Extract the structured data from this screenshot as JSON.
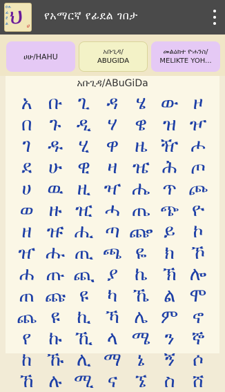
{
  "app": {
    "title": "የአማርኛ የፊደል ገበታ",
    "logo_main": "ህ",
    "logo_side": "የሐ ፊ ደ ል",
    "logo_corner": "ሀ"
  },
  "tabs": [
    {
      "line1": "ሀሁ/HAHU",
      "line2": ""
    },
    {
      "line1": "አቡጊዳ/",
      "line2": "ABUGIDA"
    },
    {
      "line1": "መልዕክተ ዮሐንስ/",
      "line2": "MELIKTE YOH..."
    }
  ],
  "content": {
    "subtitle": "አቡጊዳ/ABuGiDa"
  },
  "grid_rows": [
    [
      "አ",
      "ቡ",
      "ጊ",
      "ዳ",
      "ሄ",
      "ው",
      "ዞ"
    ],
    [
      "በ",
      "ጉ",
      "ዲ",
      "ሃ",
      "ዌ",
      "ዝ",
      "ዦ"
    ],
    [
      "ገ",
      "ዱ",
      "ሂ",
      "ዋ",
      "ዜ",
      "ዥ",
      "ሖ"
    ],
    [
      "ደ",
      "ሁ",
      "ዊ",
      "ዛ",
      "ዤ",
      "ሕ",
      "ጦ"
    ],
    [
      "ሀ",
      "ዉ",
      "ዚ",
      "ዣ",
      "ሔ",
      "ጥ",
      "ጮ"
    ],
    [
      "ወ",
      "ዙ",
      "ዢ",
      "ሓ",
      "ጤ",
      "ጭ",
      "ዮ"
    ],
    [
      "ዘ",
      "ዡ",
      "ሒ",
      "ጣ",
      "ጬ",
      "ይ",
      "ኮ"
    ],
    [
      "ዠ",
      "ሑ",
      "ጢ",
      "ጫ",
      "ዬ",
      "ክ",
      "ኾ"
    ],
    [
      "ሐ",
      "ጡ",
      "ጪ",
      "ያ",
      "ኬ",
      "ኽ",
      "ሎ"
    ],
    [
      "ጠ",
      "ጩ",
      "ዩ",
      "ካ",
      "ኼ",
      "ል",
      "ሞ"
    ],
    [
      "ጨ",
      "ዩ",
      "ኪ",
      "ኻ",
      "ሌ",
      "ም",
      "ኖ"
    ],
    [
      "የ",
      "ኩ",
      "ኺ",
      "ላ",
      "ሜ",
      "ን",
      "ኞ"
    ],
    [
      "ከ",
      "ኹ",
      "ሊ",
      "ማ",
      "ኔ",
      "ኝ",
      "ሶ"
    ],
    [
      "ኸ",
      "ሉ",
      "ሚ",
      "ና",
      "ኜ",
      "ስ",
      "ሸ"
    ]
  ]
}
